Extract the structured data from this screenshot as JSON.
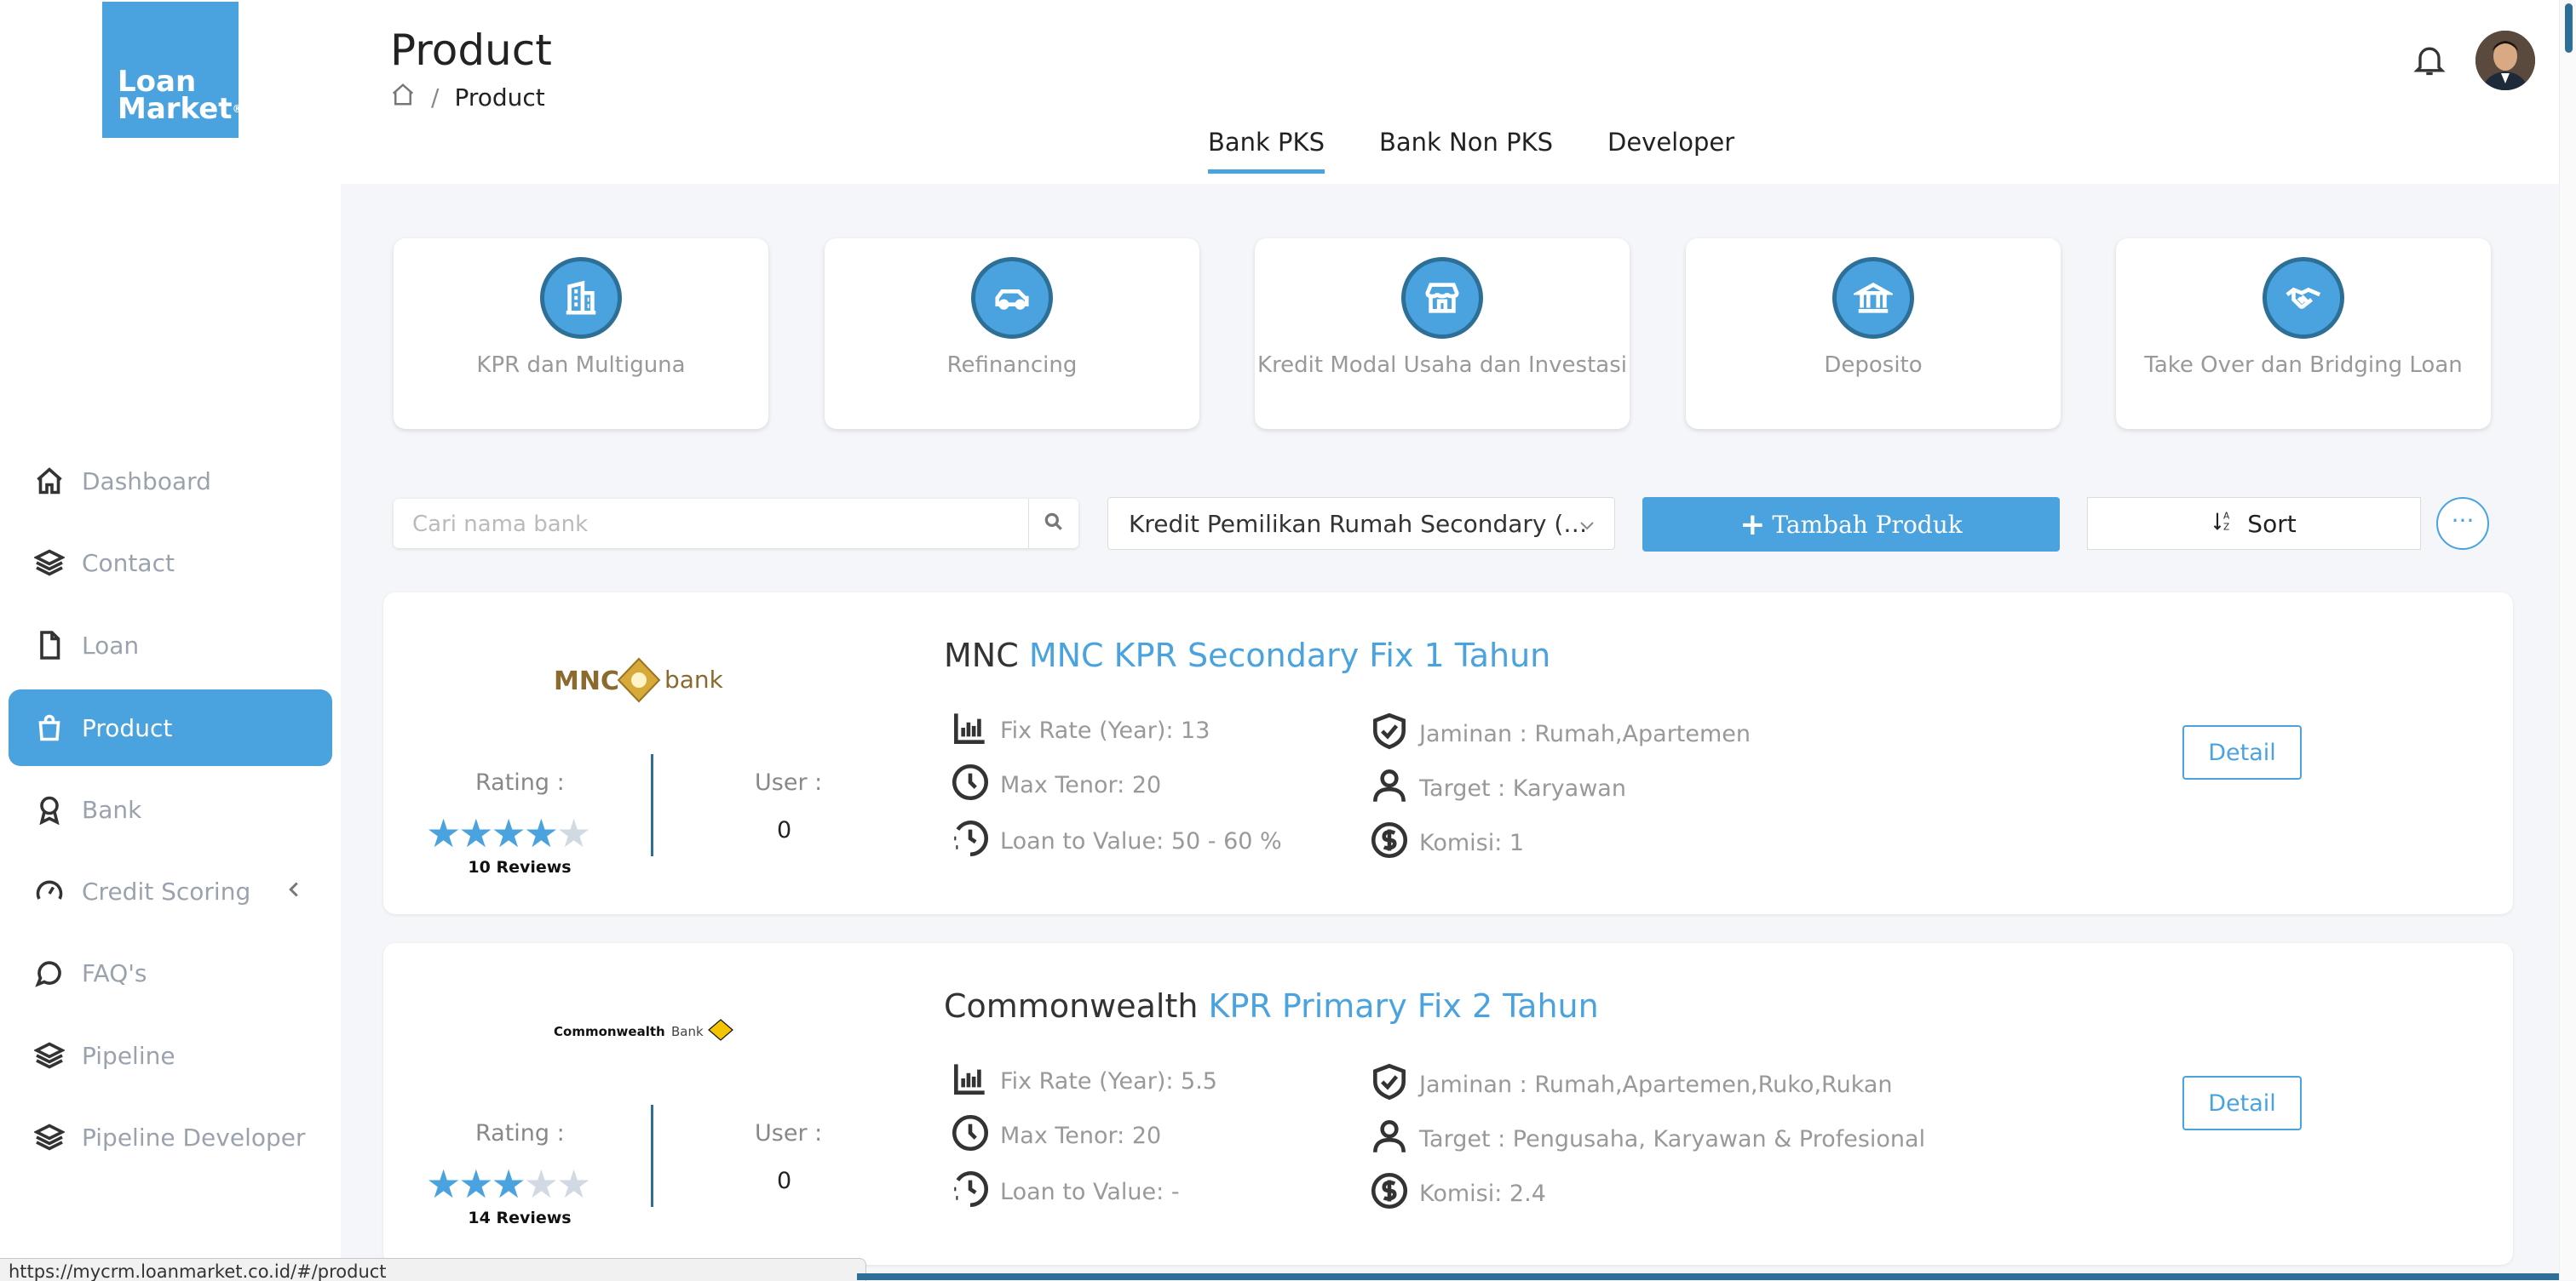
{
  "app": {
    "logo_line1": "Loan",
    "logo_line2": "Market",
    "brand_color": "#4aa3df",
    "dark_accent": "#2e6f97"
  },
  "sidebar": {
    "items": [
      {
        "label": "Dashboard",
        "icon": "home-icon"
      },
      {
        "label": "Contact",
        "icon": "layers-icon"
      },
      {
        "label": "Loan",
        "icon": "document-icon"
      },
      {
        "label": "Product",
        "icon": "shopping-bag-icon",
        "active": true
      },
      {
        "label": "Bank",
        "icon": "award-icon"
      },
      {
        "label": "Credit Scoring",
        "icon": "gauge-icon"
      },
      {
        "label": "FAQ's",
        "icon": "chat-icon"
      },
      {
        "label": "Pipeline",
        "icon": "layers-icon"
      },
      {
        "label": "Pipeline Developer",
        "icon": "layers-icon"
      }
    ]
  },
  "header": {
    "title": "Product",
    "breadcrumb_current": "Product",
    "tabs": [
      {
        "label": "Bank PKS",
        "active": true
      },
      {
        "label": "Bank Non PKS"
      },
      {
        "label": "Developer"
      }
    ]
  },
  "categories": [
    {
      "label": "KPR dan Multiguna",
      "icon": "building-icon"
    },
    {
      "label": "Refinancing",
      "icon": "car-icon"
    },
    {
      "label": "Kredit Modal Usaha dan Investasi",
      "icon": "store-icon"
    },
    {
      "label": "Deposito",
      "icon": "bank-icon"
    },
    {
      "label": "Take Over dan Bridging Loan",
      "icon": "handshake-icon"
    }
  ],
  "toolbar": {
    "search_placeholder": "Cari nama bank",
    "select_value": "Kredit Pemilikan Rumah Secondary (…",
    "add_label": "Tambah Produk",
    "sort_label": "Sort",
    "more_label": "···"
  },
  "products": [
    {
      "bank": "MNC",
      "name": "MNC KPR Secondary Fix 1 Tahun",
      "logo_text_1": "MNC",
      "logo_text_2": "bank",
      "rating_label": "Rating :",
      "rating": 4,
      "reviews": "10 Reviews",
      "user_label": "User :",
      "users": "0",
      "fix_rate": "Fix Rate (Year): 13",
      "max_tenor": "Max Tenor: 20",
      "ltv": "Loan to Value: 50 - 60 %",
      "jaminan": "Jaminan : Rumah,Apartemen",
      "target": "Target : Karyawan",
      "komisi": "Komisi: 1",
      "detail_label": "Detail"
    },
    {
      "bank": "Commonwealth",
      "name": "KPR Primary Fix 2 Tahun",
      "logo_text_1": "Commonwealth",
      "logo_text_2": "Bank",
      "rating_label": "Rating :",
      "rating": 3,
      "reviews": "14 Reviews",
      "user_label": "User :",
      "users": "0",
      "fix_rate": "Fix Rate (Year): 5.5",
      "max_tenor": "Max Tenor: 20",
      "ltv": "Loan to Value: -",
      "jaminan": "Jaminan : Rumah,Apartemen,Ruko,Rukan",
      "target": "Target : Pengusaha, Karyawan & Profesional",
      "komisi": "Komisi: 2.4",
      "detail_label": "Detail"
    }
  ],
  "status_url": "https://mycrm.loanmarket.co.id/#/product"
}
